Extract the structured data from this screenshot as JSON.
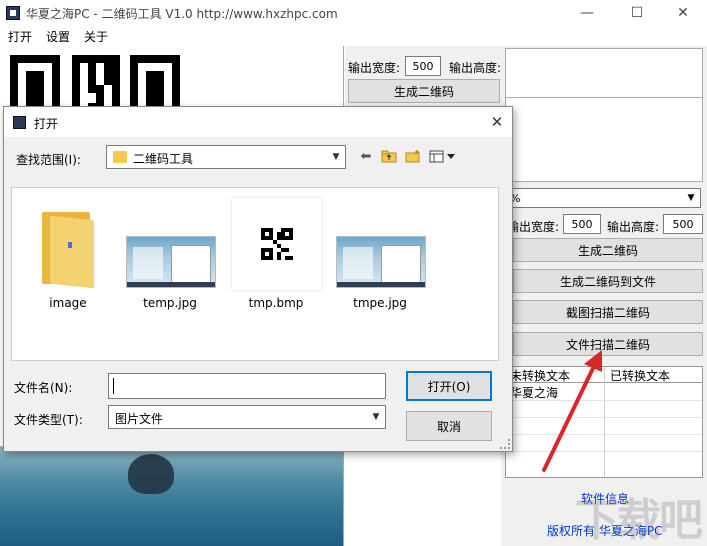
{
  "window": {
    "title": "华夏之海PC - 二维码工具 V1.0  http://www.hxzhpc.com",
    "min_glyph": "—",
    "max_glyph": "☐",
    "close_glyph": "✕"
  },
  "menu": [
    "打开",
    "设置",
    "关于"
  ],
  "settings": {
    "width_label": "输出宽度:",
    "width_value": "500",
    "height_label": "输出高度:",
    "generate_label": "生成二维码"
  },
  "right": {
    "combo_value": "%",
    "width_label": "输出宽度:",
    "width_value": "500",
    "height_label": "输出高度:",
    "height_value": "500",
    "buttons": [
      "生成二维码",
      "生成二维码到文件",
      "截图扫描二维码",
      "文件扫描二维码"
    ],
    "grid_headers": [
      "未转换文本",
      "已转换文本"
    ],
    "grid_rows": [
      [
        "华夏之海",
        ""
      ]
    ],
    "software_info": "软件信息",
    "copyright": "版权所有  华夏之海PC",
    "watermark": "下载吧"
  },
  "dialog": {
    "title": "打开",
    "lookin_label": "查找范围(I):",
    "lookin_value": "二维码工具",
    "files": [
      {
        "name": "image",
        "kind": "folder-icon"
      },
      {
        "name": "temp.jpg",
        "kind": "screenshot-thumbnail"
      },
      {
        "name": "tmp.bmp",
        "kind": "qr-thumbnail"
      },
      {
        "name": "tmpe.jpg",
        "kind": "screenshot-thumbnail"
      }
    ],
    "filename_label": "文件名(N):",
    "filename_value": "",
    "filetype_label": "文件类型(T):",
    "filetype_value": "图片文件",
    "open_button": "打开(O)",
    "cancel_button": "取消"
  },
  "colors": {
    "accent": "#0078d7",
    "link": "#0033cc",
    "arrow": "#d62828"
  }
}
